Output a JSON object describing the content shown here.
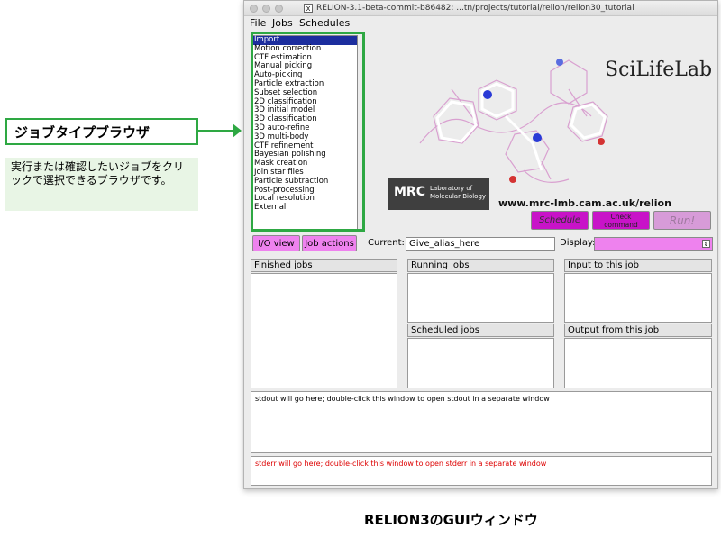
{
  "annotation": {
    "callout_label": "ジョブタイプブラウザ",
    "description": "実行または確認したいジョブをクリックで選択できるブラウザです。",
    "accent_color": "#2ea843"
  },
  "window": {
    "title": "RELION-3.1-beta-commit-b86482: ...tn/projects/tutorial/relion/relion30_tutorial",
    "x_icon": "X",
    "menu": [
      "File",
      "Jobs",
      "Schedules"
    ]
  },
  "job_types": [
    "Import",
    "Motion correction",
    "CTF estimation",
    "Manual picking",
    "Auto-picking",
    "Particle extraction",
    "Subset selection",
    "2D classification",
    "3D initial model",
    "3D classification",
    "3D auto-refine",
    "3D multi-body",
    "CTF refinement",
    "Bayesian polishing",
    "Mask creation",
    "Join star files",
    "Particle subtraction",
    "Post-processing",
    "Local resolution",
    "External"
  ],
  "selected_job": "Import",
  "branding": {
    "scilife": "SciLifeLab",
    "mrc": "MRC",
    "mrc_sub1": "Laboratory of",
    "mrc_sub2": "Molecular Biology",
    "url": "www.mrc-lmb.cam.ac.uk/relion"
  },
  "buttons": {
    "schedule": "Schedule",
    "check_command": "Check command",
    "run": "Run!",
    "io_view": "I/O view",
    "job_actions": "Job actions"
  },
  "current": {
    "label": "Current:",
    "value": "Give_alias_here"
  },
  "display": {
    "label": "Display:",
    "value": ""
  },
  "panels": {
    "finished": "Finished jobs",
    "running": "Running jobs",
    "scheduled": "Scheduled jobs",
    "input": "Input to this job",
    "output": "Output from this job"
  },
  "stdout_text": "stdout will go here; double-click this window to open stdout in a separate window",
  "stderr_text": "stderr will go here; double-click this window to open stderr in a separate window",
  "caption": "RELION3のGUIウィンドウ",
  "colors": {
    "button_magenta": "#ee82ee",
    "schedule_purple": "#c813c8",
    "selection_blue": "#1c2e9e",
    "stderr_red": "#dd0000"
  }
}
